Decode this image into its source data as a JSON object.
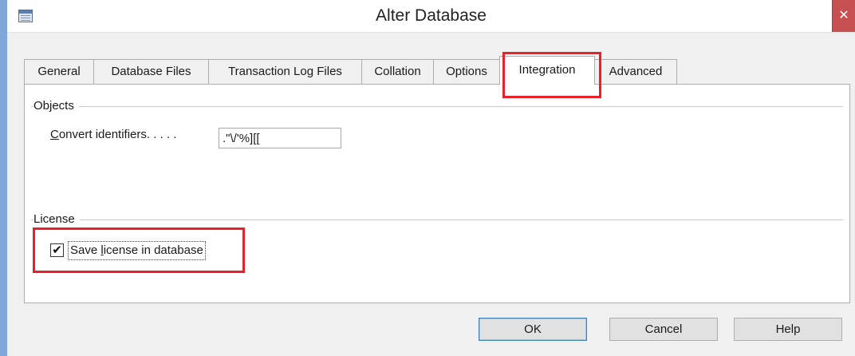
{
  "window": {
    "title": "Alter Database",
    "app_icon": "table-icon",
    "close_icon": "close-icon"
  },
  "tabs": [
    {
      "label": "General",
      "active": false
    },
    {
      "label": "Database Files",
      "active": false
    },
    {
      "label": "Transaction Log Files",
      "active": false
    },
    {
      "label": "Collation",
      "active": false
    },
    {
      "label": "Options",
      "active": false
    },
    {
      "label": "Integration",
      "active": true
    },
    {
      "label": "Advanced",
      "active": false
    }
  ],
  "objects": {
    "group_label": "Objects",
    "convert_label_accel": "C",
    "convert_label_rest": "onvert identifiers. . . . .",
    "convert_value": ".\"\\/'%][["
  },
  "license": {
    "group_label": "License",
    "save_checked": true,
    "check_mark": "✔",
    "save_label_pre": "Save ",
    "save_label_accel": "l",
    "save_label_post": "icense in database"
  },
  "buttons": {
    "ok": "OK",
    "cancel": "Cancel",
    "help": "Help"
  },
  "colors": {
    "highlight": "#e8202a",
    "close_button": "#c75050"
  }
}
